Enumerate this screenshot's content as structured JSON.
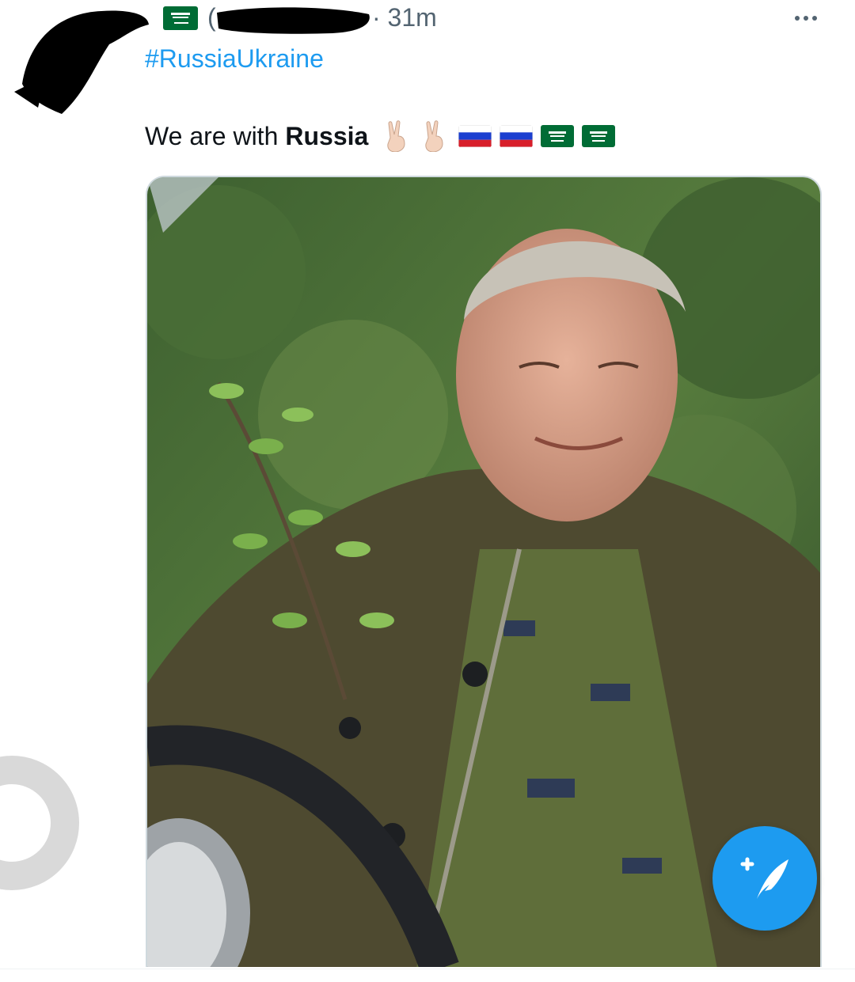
{
  "header": {
    "username_fragment": "(",
    "timestamp": "· 31m",
    "more_icon": "more-horizontal-icon"
  },
  "tweet": {
    "hashtag": "#RussiaUkraine",
    "text_prefix": "We are with",
    "text_bold": "Russia",
    "emojis": [
      "peace-hand",
      "peace-hand",
      "russia-flag",
      "russia-flag",
      "saudi-flag",
      "saudi-flag"
    ]
  },
  "media": {
    "description_icon": "photo"
  },
  "colors": {
    "accent": "#1d9bf0",
    "secondary_text": "#536471",
    "text": "#0f1419",
    "border": "#cfd9de"
  },
  "fab": {
    "icon": "compose-tweet-icon"
  }
}
